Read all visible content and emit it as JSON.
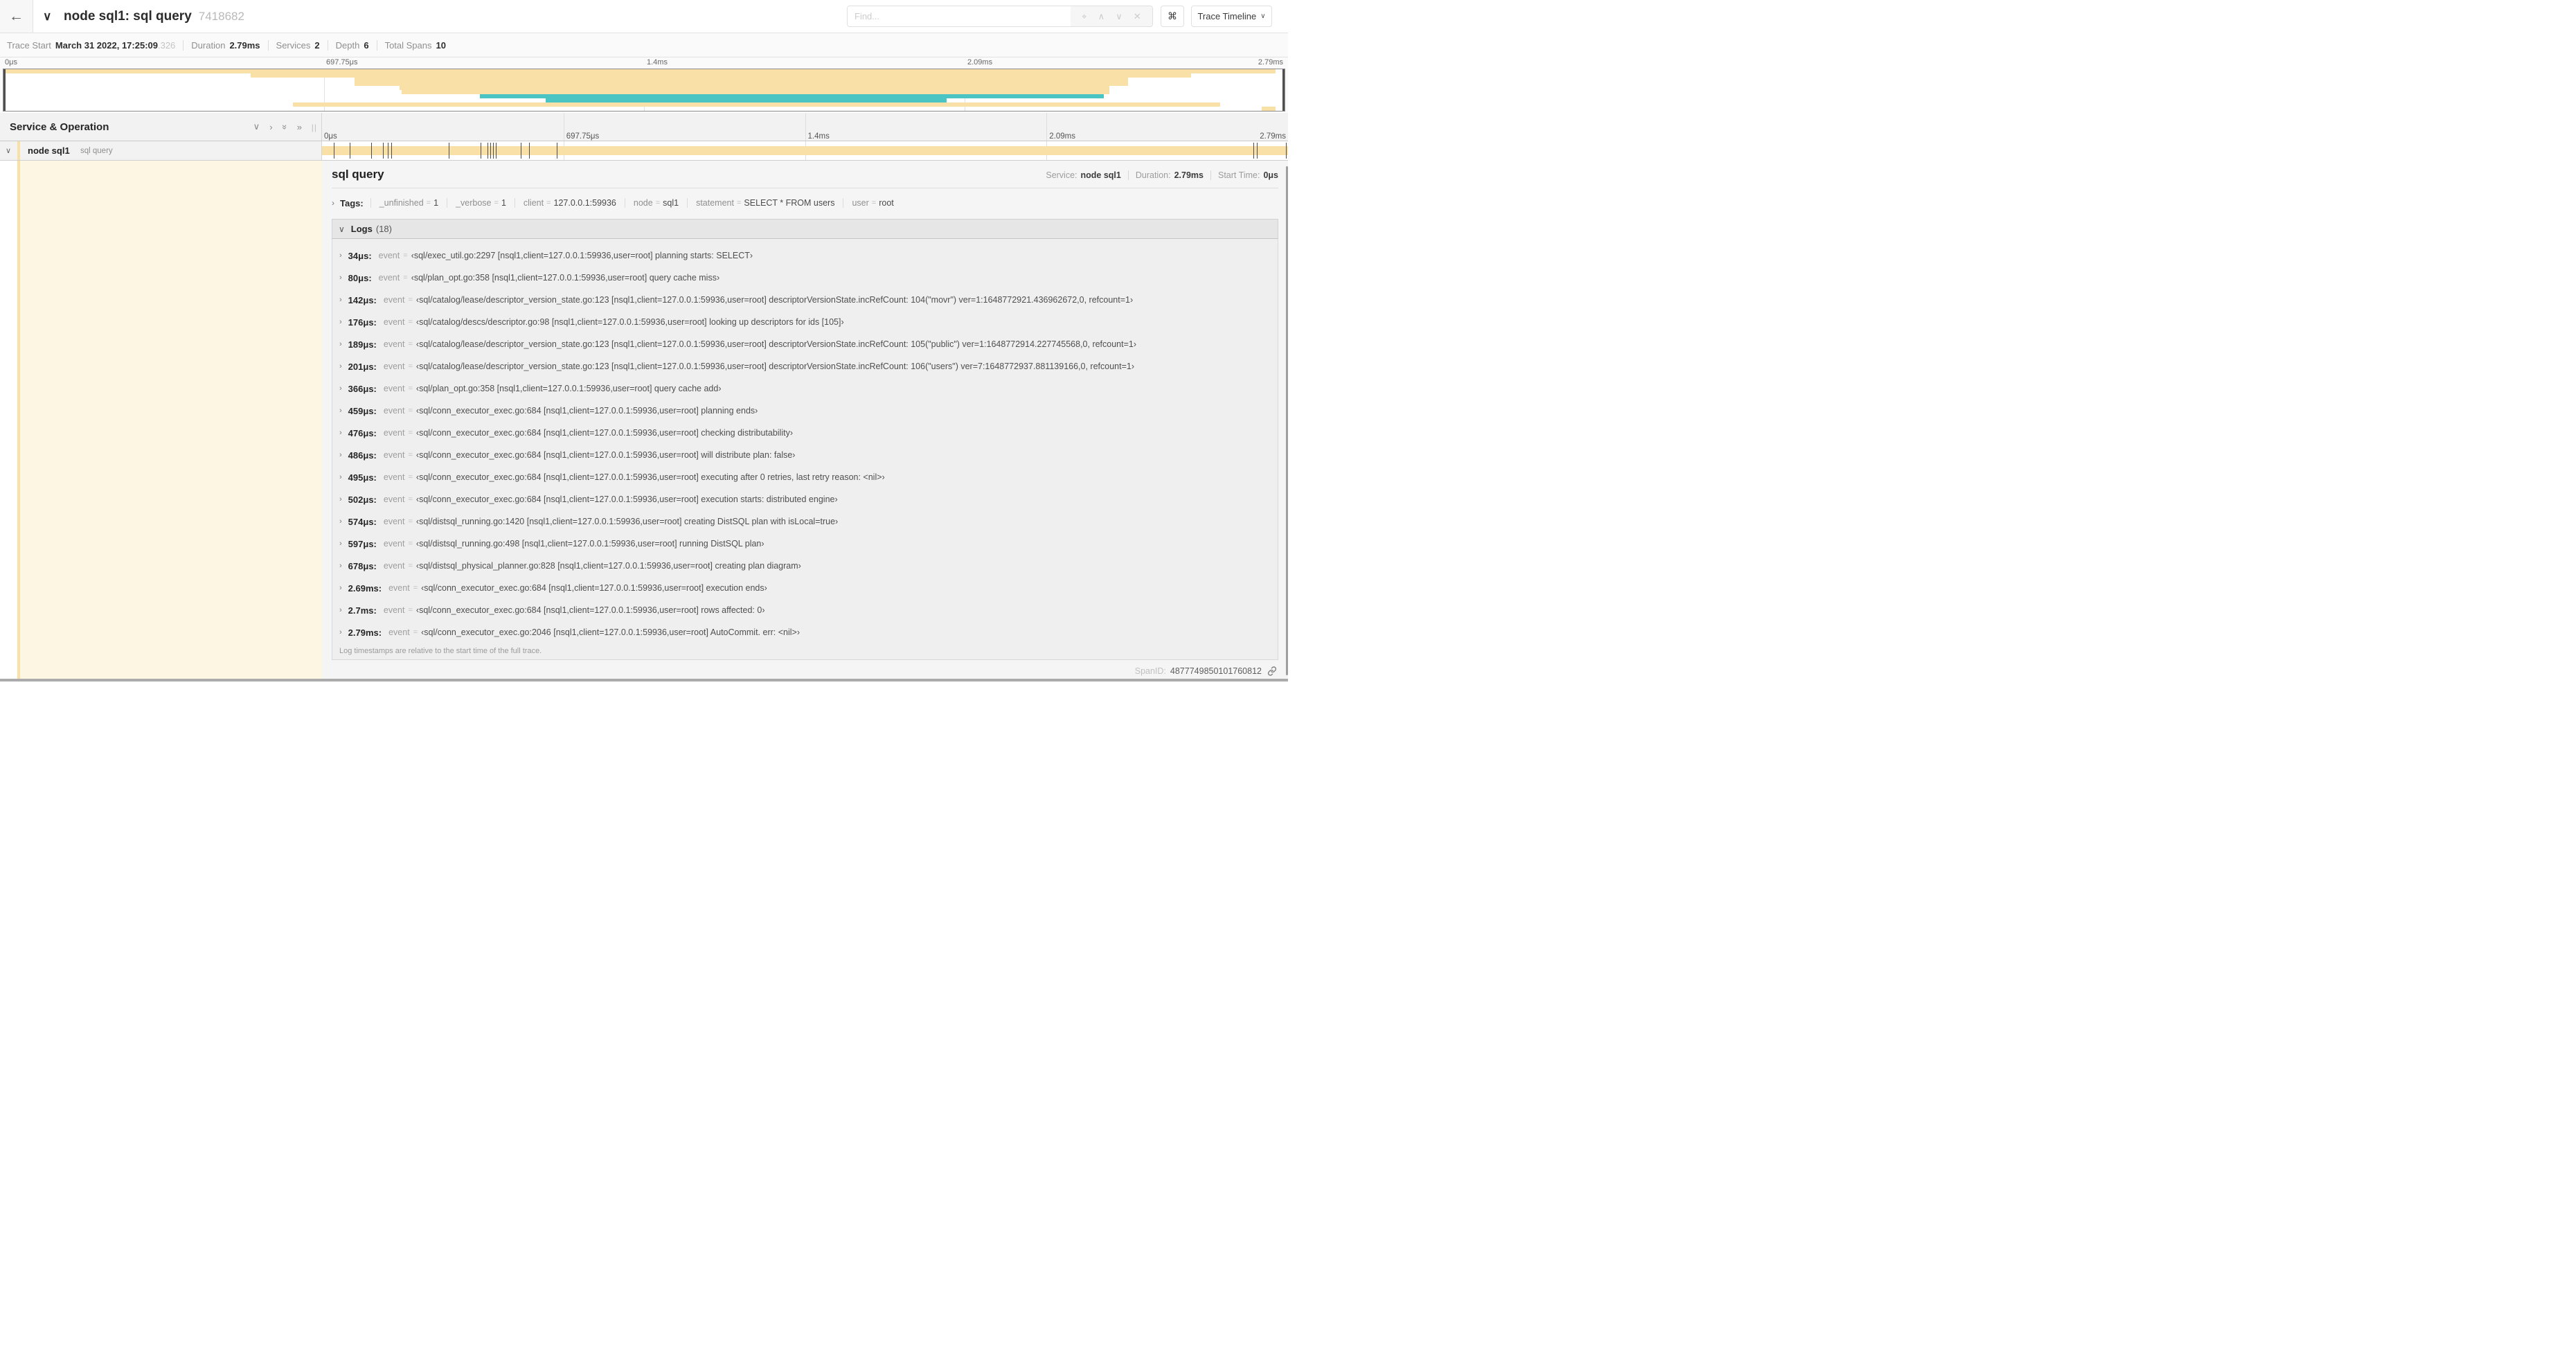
{
  "icons": {
    "back": "←",
    "chevron_down": "∨",
    "chevron_right": "›",
    "double_chevron_right": "»",
    "grip": "||",
    "target": "⌖",
    "up": "∧",
    "down": "∨",
    "close": "✕",
    "cmd": "⌘",
    "link": "link-icon"
  },
  "header": {
    "title": "node sql1: sql query",
    "trace_id": "7418682",
    "find_placeholder": "Find...",
    "view_button": "Trace Timeline"
  },
  "summary": {
    "items": [
      {
        "label": "Trace Start",
        "value": "March 31 2022, 17:25:09",
        "suffix": ".326"
      },
      {
        "label": "Duration",
        "value": "2.79ms"
      },
      {
        "label": "Services",
        "value": "2"
      },
      {
        "label": "Depth",
        "value": "6"
      },
      {
        "label": "Total Spans",
        "value": "10"
      }
    ]
  },
  "timeline": {
    "ticks": [
      "0μs",
      "697.75μs",
      "1.4ms",
      "2.09ms",
      "2.79ms"
    ],
    "tick_positions_pct": [
      0,
      25,
      50,
      75,
      100
    ]
  },
  "minimap": {
    "rows": [
      {
        "row": 0,
        "start_pct": 0,
        "end_pct": 99.3,
        "color": "span_orange"
      },
      {
        "row": 1,
        "start_pct": 19.3,
        "end_pct": 92.7,
        "color": "span_orange"
      },
      {
        "row": 2,
        "start_pct": 27.4,
        "end_pct": 87.8,
        "color": "span_orange"
      },
      {
        "row": 3,
        "start_pct": 27.4,
        "end_pct": 87.8,
        "color": "span_orange"
      },
      {
        "row": 4,
        "start_pct": 30.9,
        "end_pct": 86.3,
        "color": "span_orange"
      },
      {
        "row": 5,
        "start_pct": 31.1,
        "end_pct": 86.3,
        "color": "span_orange"
      },
      {
        "row": 6,
        "start_pct": 37.2,
        "end_pct": 85.9,
        "color": "span_teal"
      },
      {
        "row": 7,
        "start_pct": 42.3,
        "end_pct": 73.6,
        "color": "span_teal"
      },
      {
        "row": 8,
        "start_pct": 22.6,
        "end_pct": 95.0,
        "color": "span_orange"
      },
      {
        "row": 9,
        "start_pct": 98.2,
        "end_pct": 99.3,
        "color": "span_orange"
      }
    ]
  },
  "left_panel": {
    "title": "Service & Operation"
  },
  "span_row": {
    "service": "node sql1",
    "operation": "sql query",
    "bar_start_pct": 0,
    "bar_end_pct": 100,
    "log_marker_pcts": [
      1.2,
      2.9,
      5.1,
      6.3,
      6.8,
      7.2,
      13.1,
      16.4,
      17.1,
      17.4,
      17.7,
      18.0,
      20.6,
      21.4,
      24.3,
      96.4,
      96.8,
      99.8
    ]
  },
  "detail": {
    "title": "sql query",
    "meta": [
      {
        "label": "Service:",
        "value": "node sql1"
      },
      {
        "label": "Duration:",
        "value": "2.79ms"
      },
      {
        "label": "Start Time:",
        "value": "0μs"
      }
    ],
    "tags_label": "Tags:",
    "tags": [
      {
        "key": "_unfinished",
        "value": "1"
      },
      {
        "key": "_verbose",
        "value": "1"
      },
      {
        "key": "client",
        "value": "127.0.0.1:59936"
      },
      {
        "key": "node",
        "value": "sql1"
      },
      {
        "key": "statement",
        "value": "SELECT * FROM users"
      },
      {
        "key": "user",
        "value": "root"
      }
    ],
    "logs_label": "Logs",
    "logs_count": "(18)",
    "log_key_label": "event",
    "logs": [
      {
        "time": "34μs:",
        "value": "‹sql/exec_util.go:2297 [nsql1,client=127.0.0.1:59936,user=root] planning starts: SELECT›"
      },
      {
        "time": "80μs:",
        "value": "‹sql/plan_opt.go:358 [nsql1,client=127.0.0.1:59936,user=root] query cache miss›"
      },
      {
        "time": "142μs:",
        "value": "‹sql/catalog/lease/descriptor_version_state.go:123 [nsql1,client=127.0.0.1:59936,user=root] descriptorVersionState.incRefCount: 104(\"movr\") ver=1:1648772921.436962672,0, refcount=1›"
      },
      {
        "time": "176μs:",
        "value": "‹sql/catalog/descs/descriptor.go:98 [nsql1,client=127.0.0.1:59936,user=root] looking up descriptors for ids [105]›"
      },
      {
        "time": "189μs:",
        "value": "‹sql/catalog/lease/descriptor_version_state.go:123 [nsql1,client=127.0.0.1:59936,user=root] descriptorVersionState.incRefCount: 105(\"public\") ver=1:1648772914.227745568,0, refcount=1›"
      },
      {
        "time": "201μs:",
        "value": "‹sql/catalog/lease/descriptor_version_state.go:123 [nsql1,client=127.0.0.1:59936,user=root] descriptorVersionState.incRefCount: 106(\"users\") ver=7:1648772937.881139166,0, refcount=1›"
      },
      {
        "time": "366μs:",
        "value": "‹sql/plan_opt.go:358 [nsql1,client=127.0.0.1:59936,user=root] query cache add›"
      },
      {
        "time": "459μs:",
        "value": "‹sql/conn_executor_exec.go:684 [nsql1,client=127.0.0.1:59936,user=root] planning ends›"
      },
      {
        "time": "476μs:",
        "value": "‹sql/conn_executor_exec.go:684 [nsql1,client=127.0.0.1:59936,user=root] checking distributability›"
      },
      {
        "time": "486μs:",
        "value": "‹sql/conn_executor_exec.go:684 [nsql1,client=127.0.0.1:59936,user=root] will distribute plan: false›"
      },
      {
        "time": "495μs:",
        "value": "‹sql/conn_executor_exec.go:684 [nsql1,client=127.0.0.1:59936,user=root] executing after 0 retries, last retry reason: <nil>›"
      },
      {
        "time": "502μs:",
        "value": "‹sql/conn_executor_exec.go:684 [nsql1,client=127.0.0.1:59936,user=root] execution starts: distributed engine›"
      },
      {
        "time": "574μs:",
        "value": "‹sql/distsql_running.go:1420 [nsql1,client=127.0.0.1:59936,user=root] creating DistSQL plan with isLocal=true›"
      },
      {
        "time": "597μs:",
        "value": "‹sql/distsql_running.go:498 [nsql1,client=127.0.0.1:59936,user=root] running DistSQL plan›"
      },
      {
        "time": "678μs:",
        "value": "‹sql/distsql_physical_planner.go:828 [nsql1,client=127.0.0.1:59936,user=root] creating plan diagram›"
      },
      {
        "time": "2.69ms:",
        "value": "‹sql/conn_executor_exec.go:684 [nsql1,client=127.0.0.1:59936,user=root] execution ends›"
      },
      {
        "time": "2.7ms:",
        "value": "‹sql/conn_executor_exec.go:684 [nsql1,client=127.0.0.1:59936,user=root] rows affected: 0›"
      },
      {
        "time": "2.79ms:",
        "value": "‹sql/conn_executor_exec.go:2046 [nsql1,client=127.0.0.1:59936,user=root] AutoCommit. err: <nil>›"
      }
    ],
    "footer_note": "Log timestamps are relative to the start time of the full trace.",
    "span_id_label": "SpanID:",
    "span_id": "4877749850101760812"
  },
  "colors": {
    "span_orange": "#f8e0a6",
    "span_teal": "#4bc5c4",
    "selected_row_cream": "#fdf6e3"
  }
}
